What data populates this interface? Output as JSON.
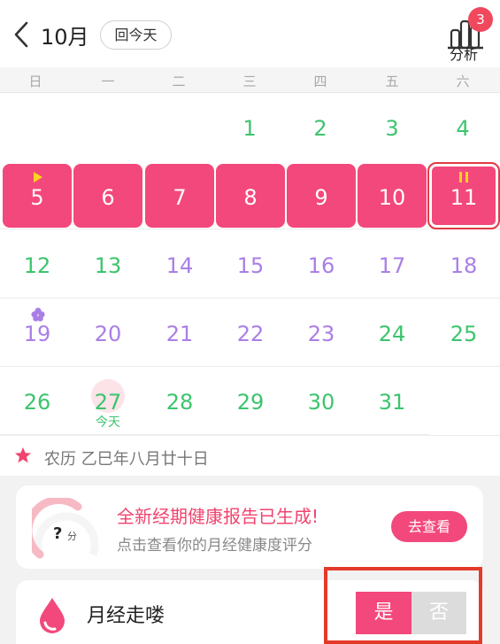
{
  "header": {
    "month": "10月",
    "today_button": "回今天",
    "analysis_label": "分析",
    "analysis_badge": "3"
  },
  "weekdays": [
    "日",
    "一",
    "二",
    "三",
    "四",
    "五",
    "六"
  ],
  "calendar": {
    "row1": [
      "1",
      "2",
      "3",
      "4"
    ],
    "row2": [
      "5",
      "6",
      "7",
      "8",
      "9",
      "10",
      "11"
    ],
    "row3": [
      "12",
      "13",
      "14",
      "15",
      "16",
      "17",
      "18"
    ],
    "row4": [
      "19",
      "20",
      "21",
      "22",
      "23",
      "24",
      "25"
    ],
    "row5": [
      "26",
      "27",
      "28",
      "29",
      "30",
      "31"
    ],
    "today_label": "今天"
  },
  "lunar": {
    "text": "农历 乙巳年八月廿十日"
  },
  "report": {
    "score_placeholder": "?",
    "score_unit": "分",
    "title": "全新经期健康报告已生成!",
    "subtitle": "点击查看你的月经健康度评分",
    "button": "去查看"
  },
  "period_card": {
    "label": "月经走喽",
    "yes": "是",
    "no": "否"
  },
  "colors": {
    "accent": "#f3487c",
    "green": "#3cc46e",
    "purple": "#a97fe6",
    "highlight": "#e43a2a"
  }
}
